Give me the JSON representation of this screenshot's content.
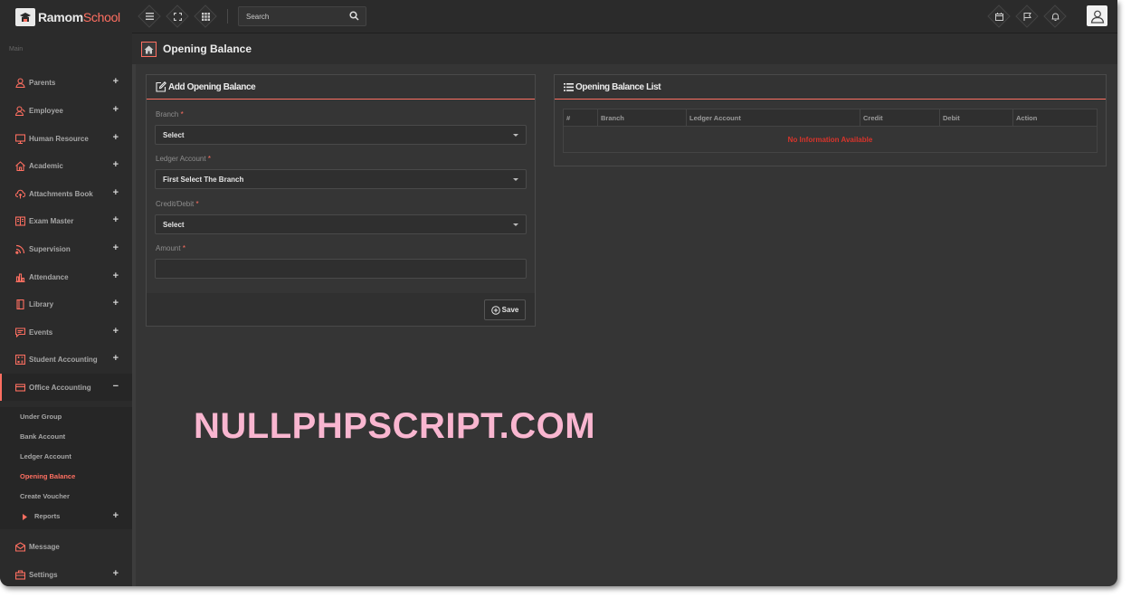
{
  "app": {
    "logo_text_a": "Ramom",
    "logo_text_b": "School"
  },
  "header": {
    "search_placeholder": "Search",
    "icons": [
      "menu-icon",
      "fullscreen-icon",
      "apps-grid-icon",
      "calendar-icon",
      "flag-icon",
      "bell-icon",
      "user-avatar-icon"
    ]
  },
  "sidebar": {
    "section_label": "Main",
    "items": [
      {
        "label": "Parents",
        "icon": "parents-icon",
        "expand": "+"
      },
      {
        "label": "Employee",
        "icon": "employee-icon",
        "expand": "+"
      },
      {
        "label": "Human Resource",
        "icon": "monitor-icon",
        "expand": "+"
      },
      {
        "label": "Academic",
        "icon": "home-icon",
        "expand": "+"
      },
      {
        "label": "Attachments Book",
        "icon": "cloud-upload-icon",
        "expand": "+"
      },
      {
        "label": "Exam Master",
        "icon": "book-icon",
        "expand": "+"
      },
      {
        "label": "Supervision",
        "icon": "rss-icon",
        "expand": "+"
      },
      {
        "label": "Attendance",
        "icon": "bar-chart-icon",
        "expand": "+"
      },
      {
        "label": "Library",
        "icon": "library-book-icon",
        "expand": "+"
      },
      {
        "label": "Events",
        "icon": "message-icon",
        "expand": "+"
      },
      {
        "label": "Student Accounting",
        "icon": "calculator-icon",
        "expand": "+"
      },
      {
        "label": "Office Accounting",
        "icon": "credit-card-icon",
        "expand": "−"
      }
    ],
    "sub_items": [
      {
        "label": "Under Group"
      },
      {
        "label": "Bank Account"
      },
      {
        "label": "Ledger Account"
      },
      {
        "label": "Opening Balance"
      },
      {
        "label": "Create Voucher"
      },
      {
        "label": "Reports",
        "expand": "+"
      }
    ],
    "bottom_items": [
      {
        "label": "Message",
        "icon": "envelope-icon"
      },
      {
        "label": "Settings",
        "icon": "briefcase-icon",
        "expand": "+"
      }
    ]
  },
  "page": {
    "title": "Opening Balance"
  },
  "form": {
    "title": "Add Opening Balance",
    "required_mark": "*",
    "branch_label": "Branch",
    "branch_value": "Select",
    "ledger_label": "Ledger Account",
    "ledger_value": "First Select The Branch",
    "creditdebit_label": "Credit/Debit",
    "creditdebit_value": "Select",
    "amount_label": "Amount",
    "amount_value": "",
    "save_label": "Save"
  },
  "list": {
    "title": "Opening Balance List",
    "columns": [
      "#",
      "Branch",
      "Ledger Account",
      "Credit",
      "Debit",
      "Action"
    ],
    "empty_message": "No Information Available"
  },
  "watermark": "NULLPHPSCRIPT.COM",
  "colors": {
    "accent": "#ff6f61",
    "error": "#d9342b",
    "background": "#353535",
    "sidebar": "#2b2b2b"
  }
}
